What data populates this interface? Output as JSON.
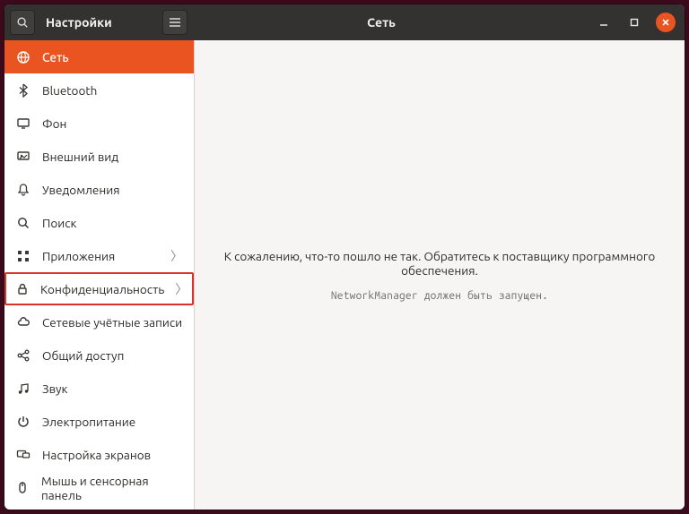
{
  "titlebar": {
    "left_title": "Настройки",
    "center_title": "Сеть"
  },
  "sidebar": {
    "items": [
      {
        "label": "Сеть",
        "icon": "globe-icon",
        "active": true,
        "submenu": false
      },
      {
        "label": "Bluetooth",
        "icon": "bluetooth-icon",
        "active": false,
        "submenu": false
      },
      {
        "label": "Фон",
        "icon": "display-icon",
        "active": false,
        "submenu": false
      },
      {
        "label": "Внешний вид",
        "icon": "appearance-icon",
        "active": false,
        "submenu": false
      },
      {
        "label": "Уведомления",
        "icon": "bell-icon",
        "active": false,
        "submenu": false
      },
      {
        "label": "Поиск",
        "icon": "search-icon",
        "active": false,
        "submenu": false
      },
      {
        "label": "Приложения",
        "icon": "apps-icon",
        "active": false,
        "submenu": true
      },
      {
        "label": "Конфиденциальность",
        "icon": "lock-icon",
        "active": false,
        "submenu": true,
        "highlight": true
      },
      {
        "label": "Сетевые учётные записи",
        "icon": "cloud-icon",
        "active": false,
        "submenu": false
      },
      {
        "label": "Общий доступ",
        "icon": "share-icon",
        "active": false,
        "submenu": false
      },
      {
        "label": "Звук",
        "icon": "music-icon",
        "active": false,
        "submenu": false
      },
      {
        "label": "Электропитание",
        "icon": "power-icon",
        "active": false,
        "submenu": false
      },
      {
        "label": "Настройка экранов",
        "icon": "displays-icon",
        "active": false,
        "submenu": false
      },
      {
        "label": "Мышь и сенсорная панель",
        "icon": "mouse-icon",
        "active": false,
        "submenu": false
      }
    ]
  },
  "content": {
    "error_message": "К сожалению, что-то пошло не так. Обратитесь к поставщику программного обеспечения.",
    "error_detail": "NetworkManager должен быть запущен."
  },
  "colors": {
    "accent": "#e95420",
    "titlebar_bg": "#333231",
    "highlight_border": "#d9342b"
  }
}
